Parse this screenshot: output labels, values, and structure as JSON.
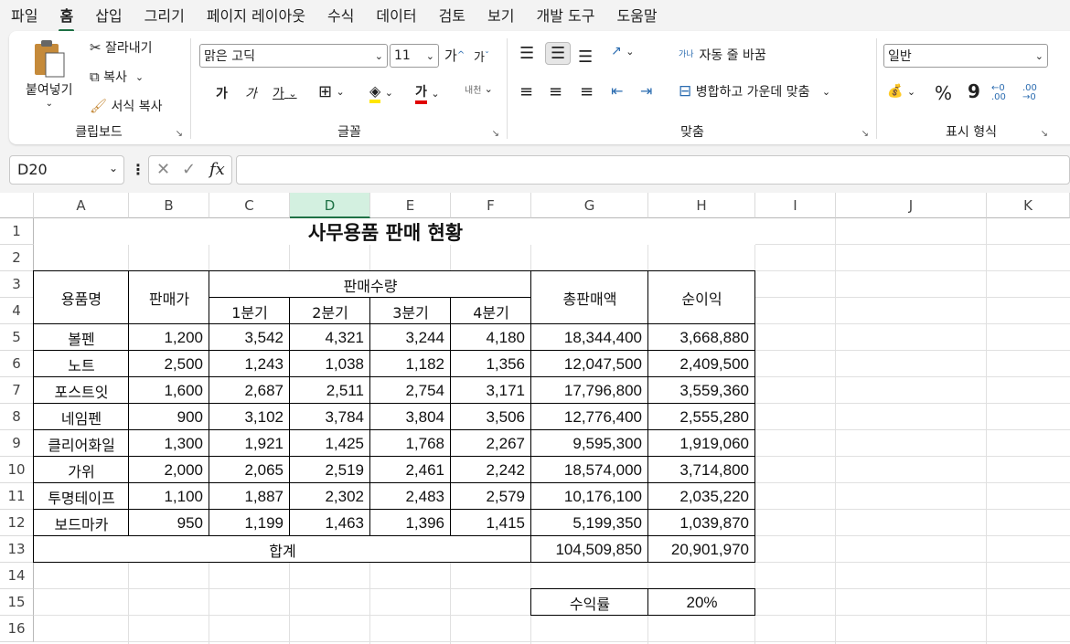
{
  "menu": [
    "파일",
    "홈",
    "삽입",
    "그리기",
    "페이지 레이아웃",
    "수식",
    "데이터",
    "검토",
    "보기",
    "개발 도구",
    "도움말"
  ],
  "clipboard": {
    "paste": "붙여넣기",
    "cut": "잘라내기",
    "copy": "복사",
    "format_painter": "서식 복사",
    "label": "클립보드"
  },
  "font": {
    "name": "맑은 고딕",
    "size": "11",
    "bold": "가",
    "italic": "가",
    "underline": "가",
    "grow": "가",
    "shrink": "가",
    "color_letter": "가",
    "phonetic": "내천",
    "label": "글꼴"
  },
  "align": {
    "wrap": "자동 줄 바꿈",
    "wrap_icon": "가나",
    "merge": "병합하고 가운데 맞춤",
    "label": "맞춤"
  },
  "number": {
    "format": "일반",
    "percent": "%",
    "comma": "9",
    "inc_decimal": "←0 .00",
    "dec_decimal": ".00 →0",
    "label": "표시 형식"
  },
  "formula_bar": {
    "cell_ref": "D20",
    "fx": "fx",
    "value": ""
  },
  "columns": [
    "A",
    "B",
    "C",
    "D",
    "E",
    "F",
    "G",
    "H",
    "I",
    "J",
    "K"
  ],
  "rows": [
    "1",
    "2",
    "3",
    "4",
    "5",
    "6",
    "7",
    "8",
    "9",
    "10",
    "11",
    "12",
    "13",
    "14",
    "15",
    "16"
  ],
  "sheet": {
    "title": "사무용품 판매 현황",
    "h_item": "용품명",
    "h_price": "판매가",
    "h_qty": "판매수량",
    "h_total": "총판매액",
    "h_profit": "순이익",
    "quarters": [
      "1분기",
      "2분기",
      "3분기",
      "4분기"
    ],
    "data": [
      [
        "볼펜",
        "1,200",
        "3,542",
        "4,321",
        "3,244",
        "4,180",
        "18,344,400",
        "3,668,880"
      ],
      [
        "노트",
        "2,500",
        "1,243",
        "1,038",
        "1,182",
        "1,356",
        "12,047,500",
        "2,409,500"
      ],
      [
        "포스트잇",
        "1,600",
        "2,687",
        "2,511",
        "2,754",
        "3,171",
        "17,796,800",
        "3,559,360"
      ],
      [
        "네임펜",
        "900",
        "3,102",
        "3,784",
        "3,804",
        "3,506",
        "12,776,400",
        "2,555,280"
      ],
      [
        "클리어화일",
        "1,300",
        "1,921",
        "1,425",
        "1,768",
        "2,267",
        "9,595,300",
        "1,919,060"
      ],
      [
        "가위",
        "2,000",
        "2,065",
        "2,519",
        "2,461",
        "2,242",
        "18,574,000",
        "3,714,800"
      ],
      [
        "투명테이프",
        "1,100",
        "1,887",
        "2,302",
        "2,483",
        "2,579",
        "10,176,100",
        "2,035,220"
      ],
      [
        "보드마카",
        "950",
        "1,199",
        "1,463",
        "1,396",
        "1,415",
        "5,199,350",
        "1,039,870"
      ]
    ],
    "sum_label": "합계",
    "sum_total": "104,509,850",
    "sum_profit": "20,901,970",
    "rate_label": "수익률",
    "rate_value": "20%"
  },
  "colors": {
    "accent": "#1e7145",
    "selected_header": "#d3f0e0"
  }
}
